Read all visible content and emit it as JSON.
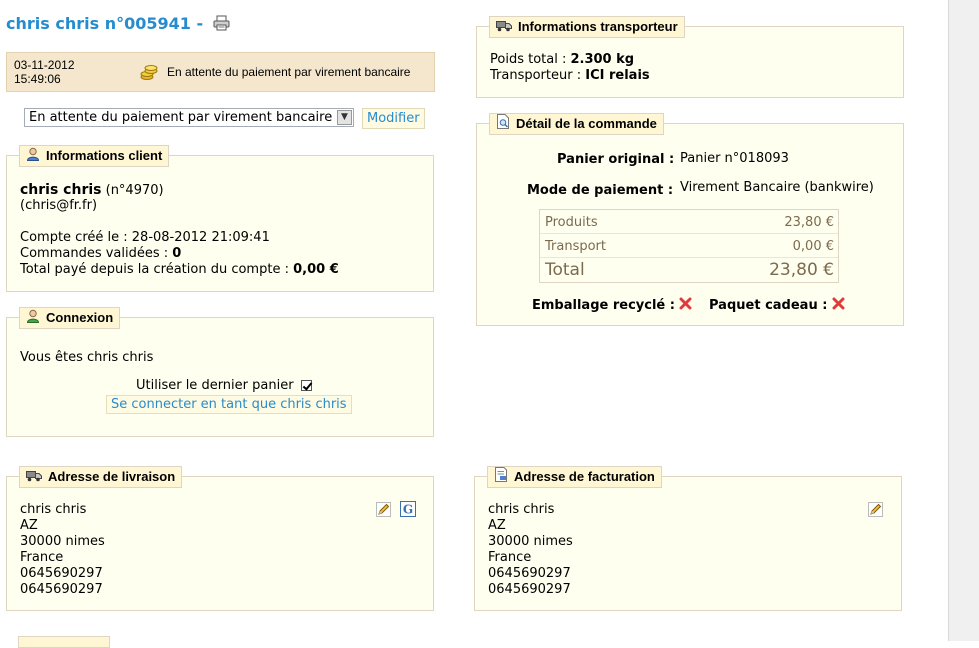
{
  "order": {
    "title": "chris chris n°005941 -",
    "printer_icon": "printer-icon"
  },
  "status": {
    "date": "03-11-2012",
    "time": "15:49:06",
    "icon": "coins-icon",
    "text": "En attente du paiement par virement bancaire"
  },
  "status_form": {
    "selected": "En attente du paiement par virement bancaire",
    "submit_label": "Modifier"
  },
  "client": {
    "legend": "Informations client",
    "name": "chris chris",
    "number": "(n°4970)",
    "email": "(chris@fr.fr)",
    "created_label": "Compte créé le :",
    "created_value": "28-08-2012 21:09:41",
    "orders_label": "Commandes validées :",
    "orders_value": "0",
    "total_label": "Total payé depuis la création du compte :",
    "total_value": "0,00 €"
  },
  "connexion": {
    "legend": "Connexion",
    "text": "Vous êtes chris chris",
    "checkbox_label": "Utiliser le dernier panier",
    "checkbox_checked": true,
    "link_label": "Se connecter en tant que chris chris"
  },
  "carrier": {
    "legend": "Informations transporteur",
    "weight_label": "Poids total :",
    "weight_value": "2.300 kg",
    "carrier_label": "Transporteur :",
    "carrier_value": "ICI relais"
  },
  "order_detail": {
    "legend": "Détail de la commande",
    "cart_label": "Panier original :",
    "cart_value": "Panier n°018093",
    "payment_label": "Mode de paiement :",
    "payment_value": "Virement Bancaire (bankwire)",
    "fees": [
      {
        "label": "Produits",
        "value": "23,80 €"
      },
      {
        "label": "Transport",
        "value": "0,00 €"
      },
      {
        "label": "Total",
        "value": "23,80 €"
      }
    ],
    "recycled_label": "Emballage recyclé :",
    "gift_label": "Paquet cadeau :"
  },
  "delivery_address": {
    "legend": "Adresse de livraison",
    "lines": [
      "chris chris",
      "AZ",
      "30000 nimes",
      "France",
      "0645690297",
      "0645690297"
    ]
  },
  "invoice_address": {
    "legend": "Adresse de facturation",
    "lines": [
      "chris chris",
      "AZ",
      "30000 nimes",
      "France",
      "0645690297",
      "0645690297"
    ]
  },
  "colors": {
    "accent_blue": "#268ccd",
    "panel_bg": "#fffff0",
    "legend_bg": "#fff6d3",
    "status_bg": "#f4e7cd",
    "fee_text": "#7c6a4e",
    "error_red": "#e03a3a"
  }
}
